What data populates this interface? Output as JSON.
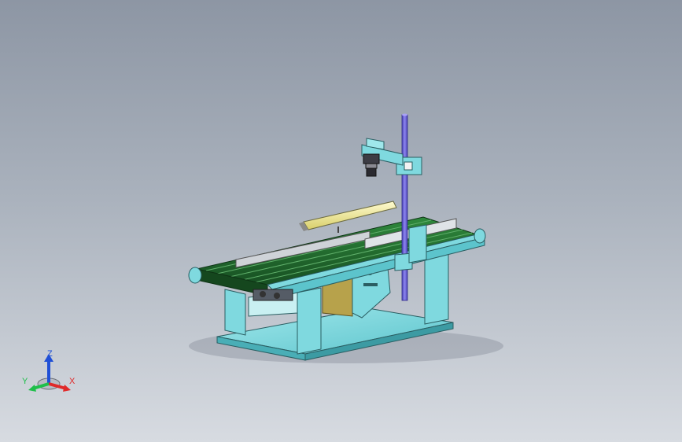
{
  "scene": {
    "description_hidden": "",
    "colors": {
      "background_top": "#8d96a4",
      "background_bottom": "#d7dbe1",
      "frame_cyan": "#7fd9df",
      "belt_green": "#1f6b2c",
      "vertical_rod": "#6d63d6",
      "light_bar": "#f2ee9a",
      "panel_olive": "#b7a24b"
    }
  },
  "triad": {
    "z_label": "Z",
    "y_label": "Y",
    "x_label": "X",
    "z_color": "#1f4fd6",
    "y_color": "#1fbf4a",
    "x_color": "#e02a2a"
  }
}
